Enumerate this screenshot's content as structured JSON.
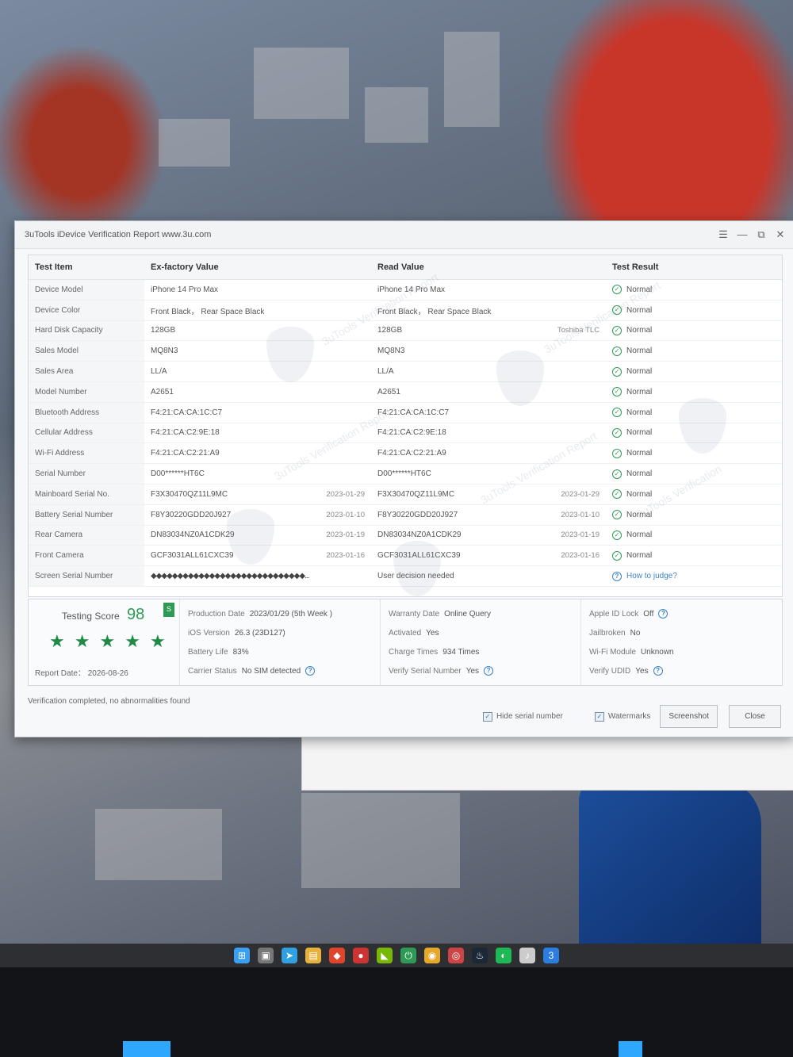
{
  "window": {
    "title": "3uTools iDevice Verification Report www.3u.com",
    "controls": [
      "☰",
      "—",
      "⧉",
      "✕"
    ]
  },
  "table": {
    "headers": {
      "item": "Test Item",
      "ex_factory": "Ex-factory Value",
      "read": "Read Value",
      "result": "Test Result"
    },
    "rows": [
      {
        "item": "Device Model",
        "ex": "iPhone 14 Pro Max",
        "ex_date": "",
        "read": "iPhone 14 Pro Max",
        "read_note": "",
        "result": "Normal"
      },
      {
        "item": "Device Color",
        "ex": "Front Black， Rear Space Black",
        "ex_date": "",
        "read": "Front Black， Rear Space Black",
        "read_note": "",
        "result": "Normal"
      },
      {
        "item": "Hard Disk Capacity",
        "ex": "128GB",
        "ex_date": "",
        "read": "128GB",
        "read_note": "Toshiba TLC",
        "result": "Normal"
      },
      {
        "item": "Sales Model",
        "ex": "MQ8N3",
        "ex_date": "",
        "read": "MQ8N3",
        "read_note": "",
        "result": "Normal"
      },
      {
        "item": "Sales Area",
        "ex": "LL/A",
        "ex_date": "",
        "read": "LL/A",
        "read_note": "",
        "result": "Normal"
      },
      {
        "item": "Model Number",
        "ex": "A2651",
        "ex_date": "",
        "read": "A2651",
        "read_note": "",
        "result": "Normal"
      },
      {
        "item": "Bluetooth Address",
        "ex": "F4:21:CA:CA:1C:C7",
        "ex_date": "",
        "read": "F4:21:CA:CA:1C:C7",
        "read_note": "",
        "result": "Normal"
      },
      {
        "item": "Cellular Address",
        "ex": "F4:21:CA:C2:9E:18",
        "ex_date": "",
        "read": "F4:21:CA:C2:9E:18",
        "read_note": "",
        "result": "Normal"
      },
      {
        "item": "Wi-Fi Address",
        "ex": "F4:21:CA:C2:21:A9",
        "ex_date": "",
        "read": "F4:21:CA:C2:21:A9",
        "read_note": "",
        "result": "Normal"
      },
      {
        "item": "Serial Number",
        "ex": "D00******HT6C",
        "ex_date": "",
        "read": "D00******HT6C",
        "read_note": "",
        "result": "Normal"
      },
      {
        "item": "Mainboard Serial No.",
        "ex": "F3X30470QZ11L9MC",
        "ex_date": "2023-01-29",
        "read": "F3X30470QZ11L9MC",
        "read_note": "2023-01-29",
        "result": "Normal"
      },
      {
        "item": "Battery Serial Number",
        "ex": "F8Y30220GDD20J927",
        "ex_date": "2023-01-10",
        "read": "F8Y30220GDD20J927",
        "read_note": "2023-01-10",
        "result": "Normal"
      },
      {
        "item": "Rear Camera",
        "ex": "DN83034NZ0A1CDK29",
        "ex_date": "2023-01-19",
        "read": "DN83034NZ0A1CDK29",
        "read_note": "2023-01-19",
        "result": "Normal"
      },
      {
        "item": "Front Camera",
        "ex": "GCF3031ALL61CXC39",
        "ex_date": "2023-01-16",
        "read": "GCF3031ALL61CXC39",
        "read_note": "2023-01-16",
        "result": "Normal"
      },
      {
        "item": "Screen Serial Number",
        "ex": "◆◆◆◆◆◆◆◆◆◆◆◆◆◆◆◆◆◆◆◆◆◆◆◆◆◆◆◆◆...",
        "ex_date": "",
        "read": "User decision needed",
        "read_note": "",
        "result": "How to judge?"
      }
    ]
  },
  "summary": {
    "score_label": "Testing Score",
    "score": "98",
    "badge": "S",
    "stars": 5,
    "report_date": "Report Date： 2026-08-26",
    "col1": [
      {
        "label": "Production Date",
        "value": "2023/01/29 (5th Week )"
      },
      {
        "label": "iOS Version",
        "value": "26.3 (23D127)"
      },
      {
        "label": "Battery Life",
        "value": "83%"
      },
      {
        "label": "Carrier Status",
        "value": "No SIM detected",
        "help": true
      }
    ],
    "col2": [
      {
        "label": "Warranty Date",
        "value": "Online Query",
        "link": true
      },
      {
        "label": "Activated",
        "value": "Yes"
      },
      {
        "label": "Charge Times",
        "value": "934 Times"
      },
      {
        "label": "Verify Serial Number",
        "value": "Yes",
        "help": true
      }
    ],
    "col3": [
      {
        "label": "Apple ID Lock",
        "value": "Off",
        "help": true
      },
      {
        "label": "Jailbroken",
        "value": "No"
      },
      {
        "label": "Wi-Fi Module",
        "value": "Unknown"
      },
      {
        "label": "Verify UDID",
        "value": "Yes",
        "help": true
      }
    ]
  },
  "footer": {
    "status": "Verification completed, no abnormalities found",
    "hide_serial": "Hide serial number",
    "watermarks": "Watermarks",
    "screenshot": "Screenshot",
    "close": "Close"
  },
  "colors": {
    "accent_green": "#2e9a55",
    "link_blue": "#3b82c6"
  },
  "taskbar_icons": [
    "windows-icon",
    "store-icon",
    "telegram-icon",
    "files-icon",
    "brave-icon",
    "app-icon",
    "nvidia-icon",
    "power-icon",
    "chrome-icon",
    "app2-icon",
    "steam-icon",
    "spotify-icon",
    "music-icon",
    "3utools-icon"
  ]
}
